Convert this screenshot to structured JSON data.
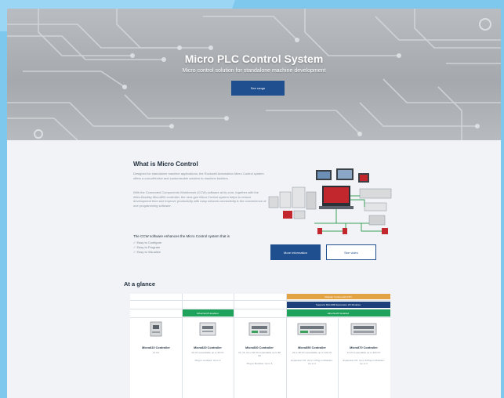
{
  "hero": {
    "title": "Micro PLC Control System",
    "subtitle": "Micro control solution for standalone machine development",
    "button": "See range"
  },
  "what": {
    "title": "What is Micro Control",
    "para1": "Designed for standalone machine applications, the Rockwell Automation Micro Control system offers a cost-effective and customizable solution to machine builders.",
    "para2": "With the Connected Components Workbench (CCW) software at its core, together with the Allen-Bradley Micro800 controller, the next-gen Micro Control system helps to reduce development time and improve productivity with easy network connectivity & the convenience of one programming software.",
    "enhance": "The CCW software enhances the Micro Control system that is",
    "checks": [
      "✓ Easy to Configure",
      "✓ Easy to Program",
      "✓ Easy to Visualize"
    ],
    "btn_more": "More information",
    "btn_video": "See video"
  },
  "glance": {
    "title": "At a glance",
    "band_orange": "Modular Control with PTO",
    "band_navy": "Supports Micro800 Expansion I/O Modules",
    "band_green_left": "EtherNet/IP Enabled",
    "band_green_right": "EtherNet/IP Enabled",
    "products": [
      {
        "name": "Micro810 Controller",
        "desc": "12 I/O",
        "extra": ""
      },
      {
        "name": "Micro820 Controller",
        "desc": "20 I/O expandable up to 36 I/O",
        "extra": "Plug-in modules: Up to 2"
      },
      {
        "name": "Micro830 Controller",
        "desc": "10, 16, 24 or 48 I/O expandable up to 88 I/O",
        "extra": "Plug-in Modules: Up to 5"
      },
      {
        "name": "Micro850 Controller",
        "desc": "24 or 48 I/O expandable up to 132 I/O",
        "extra": "Expansion I/O: Up to 4   Plug-in Modules: Up to 3"
      },
      {
        "name": "Micro870 Controller",
        "desc": "24 I/O expandable up to 304 I/O",
        "extra": "Expansion I/O: Up to 8   Plug-in Modules: Up to 3"
      }
    ]
  }
}
